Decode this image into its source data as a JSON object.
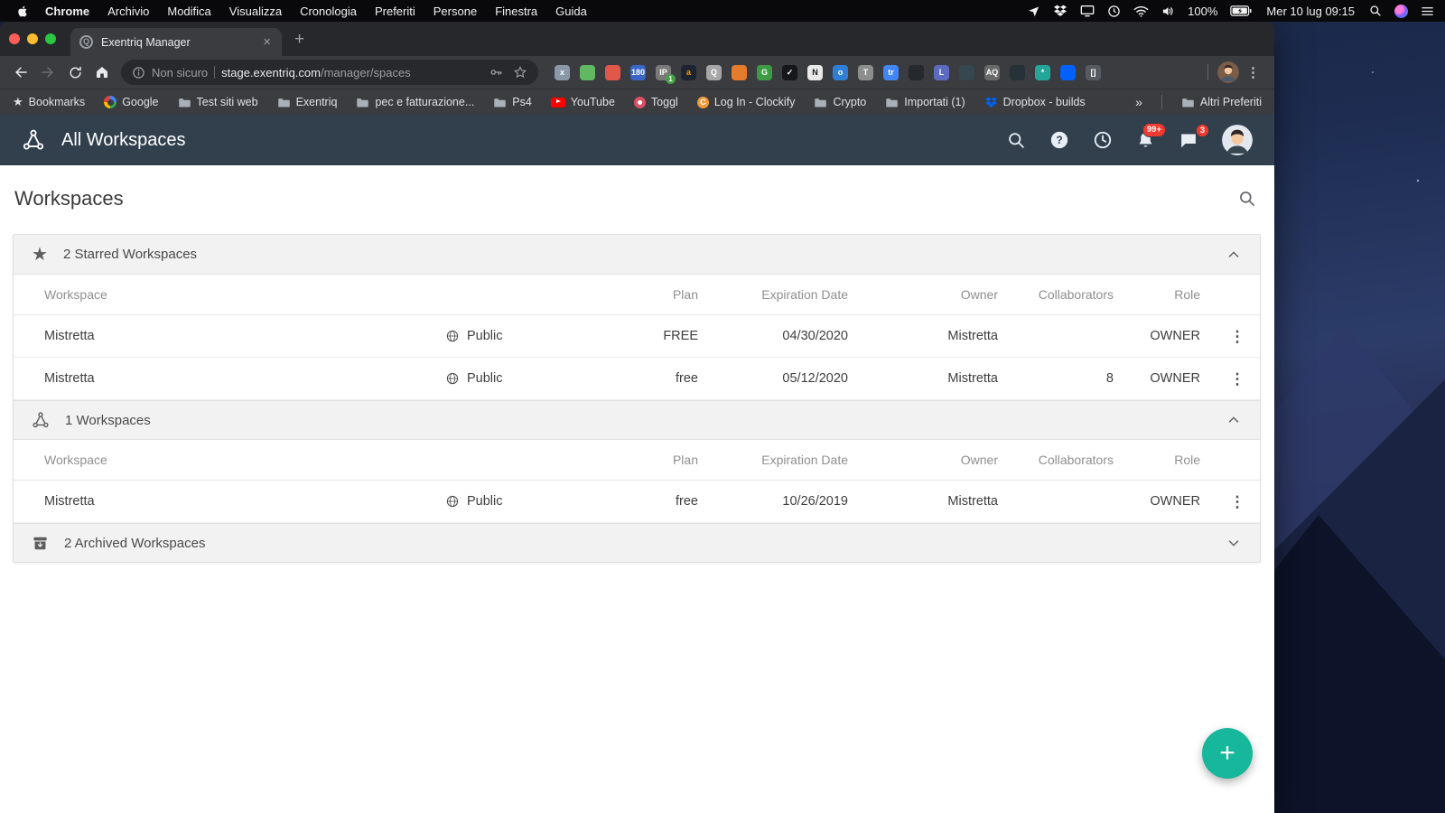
{
  "menubar": {
    "app_name": "Chrome",
    "menus": [
      "Archivio",
      "Modifica",
      "Visualizza",
      "Cronologia",
      "Preferiti",
      "Persone",
      "Finestra",
      "Guida"
    ],
    "battery_percent": "100%",
    "clock": "Mer 10 lug 09:15"
  },
  "browser": {
    "tab_title": "Exentriq Manager",
    "tab_close": "×",
    "new_tab_label": "+",
    "security_label": "Non sicuro",
    "url_host": "stage.exentriq.com",
    "url_path": "/manager/spaces",
    "bookmarks": [
      {
        "label": "Bookmarks"
      },
      {
        "label": "Google"
      },
      {
        "label": "Test siti web"
      },
      {
        "label": "Exentriq"
      },
      {
        "label": "pec e fatturazione..."
      },
      {
        "label": "Ps4"
      },
      {
        "label": "YouTube"
      },
      {
        "label": "Toggl"
      },
      {
        "label": "Log In - Clockify"
      },
      {
        "label": "Crypto"
      },
      {
        "label": "Importati (1)"
      },
      {
        "label": "Dropbox - builds"
      }
    ],
    "bookmarks_overflow": "»",
    "other_bookmarks_label": "Altri Preferiti",
    "menu_dots": "⋮",
    "extensions": [
      {
        "bg": "#8a98a8",
        "label": "x",
        "fg": "#ffffff"
      },
      {
        "bg": "#61b861",
        "label": "",
        "fg": "#ffffff"
      },
      {
        "bg": "#e2574c",
        "label": "",
        "fg": "#ffffff"
      },
      {
        "bg": "#3a66c6",
        "label": "180",
        "fg": "#ffffff"
      },
      {
        "bg": "#7a7a7a",
        "label": "IP",
        "fg": "#ffffff",
        "badge": "1"
      },
      {
        "bg": "#1b2430",
        "label": "a",
        "fg": "#ff9900"
      },
      {
        "bg": "#a7a7a7",
        "label": "Q",
        "fg": "#ffffff"
      },
      {
        "bg": "#e57b2d",
        "label": "",
        "fg": "#ffffff"
      },
      {
        "bg": "#3d9b43",
        "label": "G",
        "fg": "#ffffff"
      },
      {
        "bg": "#15171a",
        "label": "✓",
        "fg": "#ffffff"
      },
      {
        "bg": "#e9e9e9",
        "label": "N",
        "fg": "#1a1a1a"
      },
      {
        "bg": "#2f7fd6",
        "label": "o",
        "fg": "#ffffff"
      },
      {
        "bg": "#8d8d8d",
        "label": "T",
        "fg": "#ffffff"
      },
      {
        "bg": "#4285f4",
        "label": "tr",
        "fg": "#ffffff"
      },
      {
        "bg": "#24292e",
        "label": "",
        "fg": "#ffffff"
      },
      {
        "bg": "#5c6bc0",
        "label": "L",
        "fg": "#ffffff"
      },
      {
        "bg": "#37474f",
        "label": "",
        "fg": "#ffffff"
      },
      {
        "bg": "#6a6a6a",
        "label": "AQ",
        "fg": "#ffffff"
      },
      {
        "bg": "#263238",
        "label": "",
        "fg": "#ffffff"
      },
      {
        "bg": "#26a69a",
        "label": "*",
        "fg": "#ffffff"
      },
      {
        "bg": "#0061ff",
        "label": "",
        "fg": "#ffffff"
      },
      {
        "bg": "#555b61",
        "label": "[]",
        "fg": "#ffffff"
      }
    ]
  },
  "app": {
    "header_title": "All Workspaces",
    "notification_badge": "99+",
    "chat_badge": "3",
    "page_title": "Workspaces",
    "columns": [
      "Workspace",
      "Plan",
      "Expiration Date",
      "Owner",
      "Collaborators",
      "Role"
    ],
    "sections": [
      {
        "title": "2 Starred Workspaces",
        "expanded": true,
        "rows": [
          {
            "name": "Mistretta",
            "visibility": "Public",
            "plan": "FREE",
            "expiration": "04/30/2020",
            "owner": "Mistretta",
            "collaborators": "",
            "role": "OWNER"
          },
          {
            "name": "Mistretta",
            "visibility": "Public",
            "plan": "free",
            "expiration": "05/12/2020",
            "owner": "Mistretta",
            "collaborators": "8",
            "role": "OWNER"
          }
        ]
      },
      {
        "title": "1 Workspaces",
        "expanded": true,
        "rows": [
          {
            "name": "Mistretta",
            "visibility": "Public",
            "plan": "free",
            "expiration": "10/26/2019",
            "owner": "Mistretta",
            "collaborators": "",
            "role": "OWNER"
          }
        ]
      },
      {
        "title": "2 Archived Workspaces",
        "expanded": false,
        "rows": []
      }
    ],
    "row_menu": "⋮",
    "fab_label": "+",
    "fab_color": "#16b79b"
  }
}
